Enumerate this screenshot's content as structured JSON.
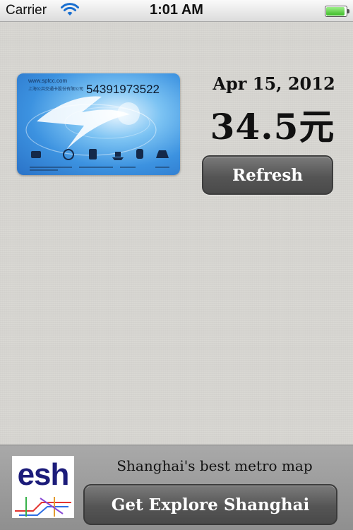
{
  "status_bar": {
    "carrier": "Carrier",
    "time": "1:01 AM",
    "wifi_icon": "wifi-icon",
    "battery_icon": "battery-icon"
  },
  "card": {
    "website": "www.sptcc.com",
    "issuer": "上海公共交通卡股份有限公司",
    "number": "54391973522",
    "date": "Apr 15, 2012",
    "balance": "34.5元",
    "refresh_label": "Refresh"
  },
  "ad": {
    "logo_text": "esh",
    "tagline": "Shanghai's best metro map",
    "button_label": "Get Explore Shanghai"
  },
  "colors": {
    "background": "#d7d6d1",
    "button": "#555555",
    "card_blue": "#3c92e0",
    "battery_green": "#3dbb27"
  }
}
